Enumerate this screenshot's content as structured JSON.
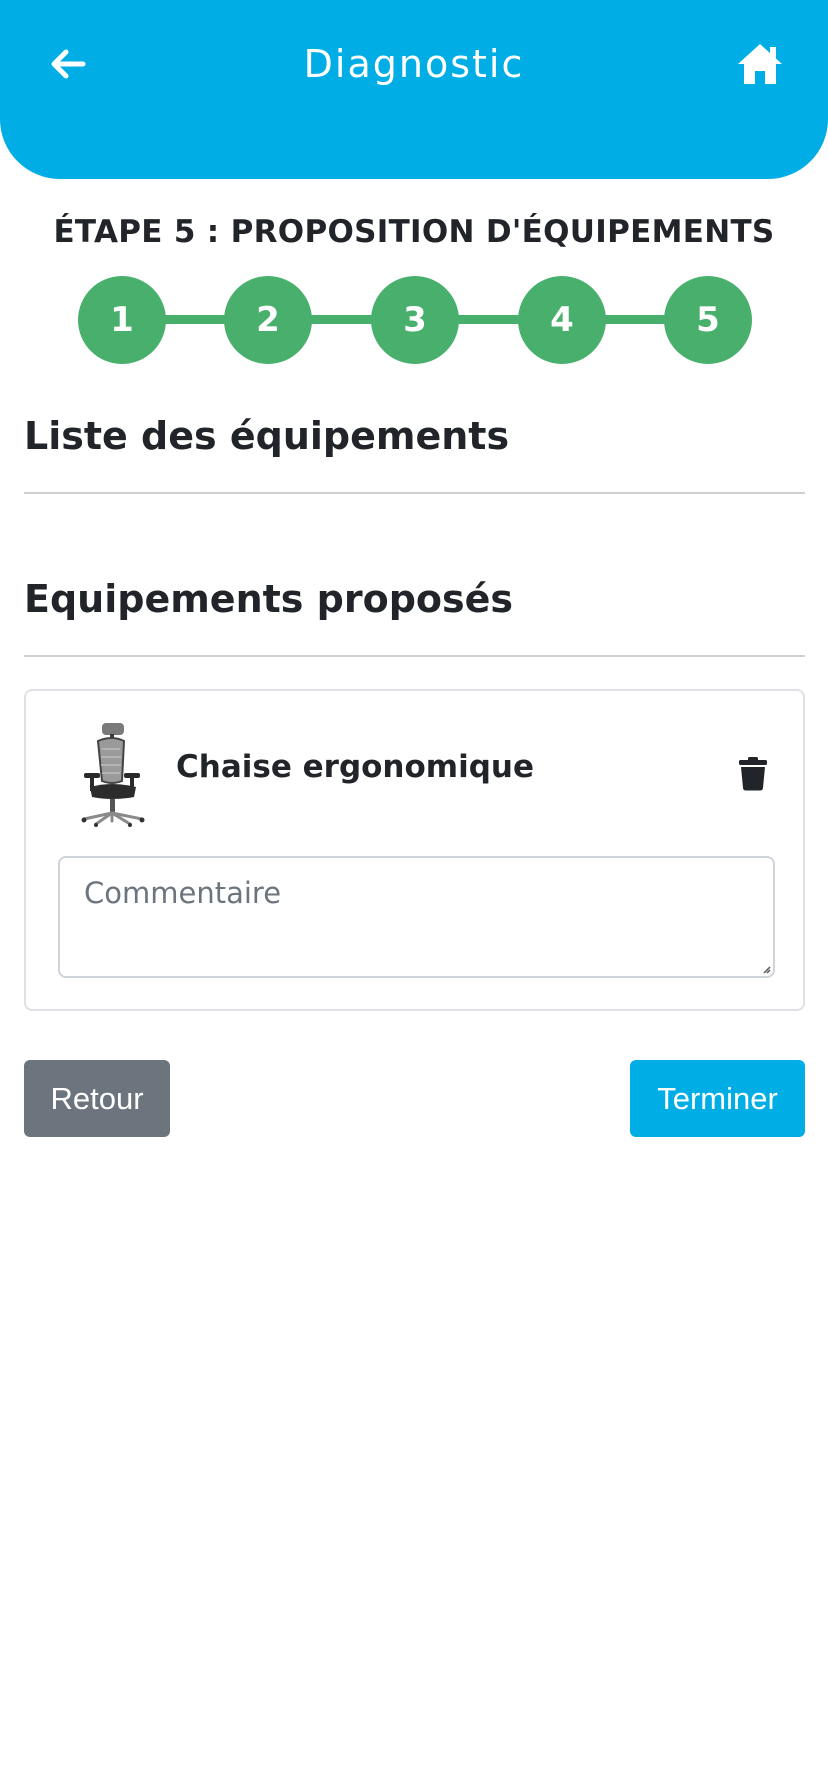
{
  "header": {
    "title": "Diagnostic",
    "back_icon": "arrow-left-icon",
    "home_icon": "home-icon",
    "background_color": "#00ADE5"
  },
  "stepper": {
    "title": "ÉTAPE 5 : PROPOSITION D'ÉQUIPEMENTS",
    "steps": [
      "1",
      "2",
      "3",
      "4",
      "5"
    ],
    "current_step": 5,
    "color": "#48B06C"
  },
  "sections": {
    "equipment_list_title": "Liste des équipements",
    "proposed_title": "Equipements proposés"
  },
  "proposed_items": [
    {
      "name": "Chaise ergonomique",
      "image_icon": "office-chair-image",
      "delete_icon": "trash-icon",
      "comment_placeholder": "Commentaire",
      "comment_value": ""
    }
  ],
  "actions": {
    "back_label": "Retour",
    "finish_label": "Terminer",
    "back_color": "#6c757d",
    "finish_color": "#00ADE5"
  }
}
